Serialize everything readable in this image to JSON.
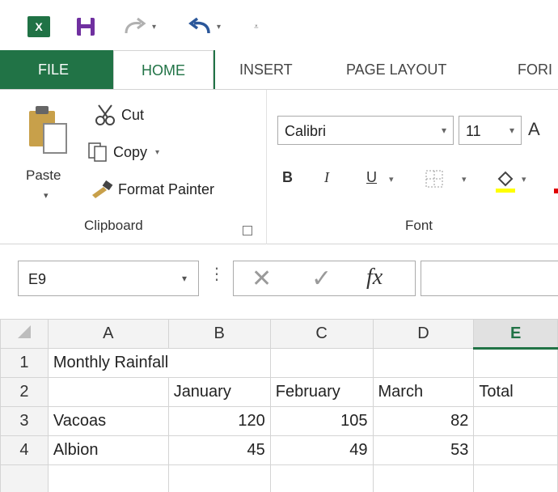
{
  "quick_access": {
    "logo": "X",
    "save_icon": "save-icon",
    "redo_icon": "redo-icon",
    "undo_icon": "undo-icon",
    "customize_icon": "customize-qat-icon"
  },
  "tabs": {
    "file": "FILE",
    "home": "HOME",
    "insert": "INSERT",
    "page_layout": "PAGE LAYOUT",
    "formulas": "FORI"
  },
  "clipboard": {
    "paste": "Paste",
    "cut": "Cut",
    "copy": "Copy",
    "format_painter": "Format Painter",
    "title": "Clipboard"
  },
  "font": {
    "name": "Calibri",
    "size": "11",
    "bold": "B",
    "italic": "I",
    "underline": "U",
    "title": "Font",
    "grow": "A"
  },
  "formula_bar": {
    "name_box": "E9",
    "dots": "⋮",
    "cancel": "✕",
    "enter": "✓",
    "fx": "fx",
    "value": ""
  },
  "sheet": {
    "columns": [
      "A",
      "B",
      "C",
      "D",
      "E"
    ],
    "rows": [
      {
        "num": "1",
        "a": "Monthly Rainfall",
        "b": "",
        "c": "",
        "d": "",
        "e": ""
      },
      {
        "num": "2",
        "a": "",
        "b": "January",
        "c": "February",
        "d": "March",
        "e": "Total"
      },
      {
        "num": "3",
        "a": "Vacoas",
        "b": "120",
        "c": "105",
        "d": "82",
        "e": ""
      },
      {
        "num": "4",
        "a": "Albion",
        "b": "45",
        "c": "49",
        "d": "53",
        "e": ""
      }
    ]
  },
  "colors": {
    "accent": "#217346",
    "header_bg": "#f3f3f3",
    "selected_header_bg": "#e1e1e1"
  }
}
